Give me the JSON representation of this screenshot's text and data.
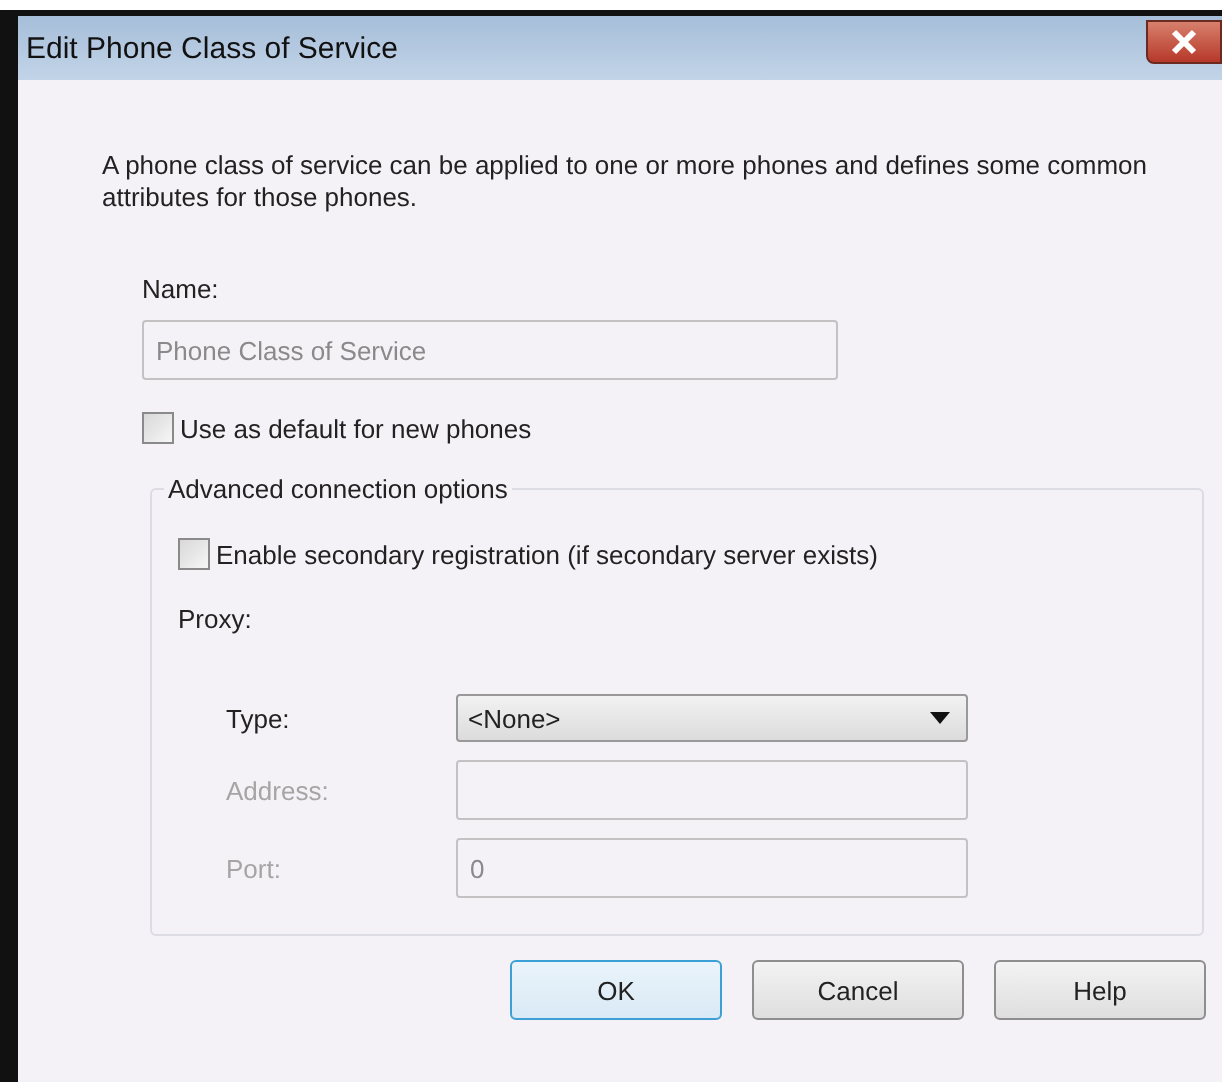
{
  "window": {
    "title": "Edit Phone Class of Service"
  },
  "description": "A phone class of service can be applied to one or more phones and defines some common attributes for those phones.",
  "name_field": {
    "label": "Name:",
    "placeholder": "Phone Class of Service",
    "disabled": true
  },
  "default_checkbox": {
    "label": "Use as default for new phones",
    "checked": false
  },
  "advanced_group": {
    "legend": "Advanced connection options",
    "secondary_checkbox": {
      "label": "Enable secondary registration (if secondary server exists)",
      "checked": false
    },
    "proxy_label": "Proxy:",
    "fields": [
      {
        "kind": "dropdown",
        "label": "Type:",
        "value": "<None>",
        "disabled": false
      },
      {
        "kind": "text",
        "label": "Address:",
        "disabled": true
      },
      {
        "kind": "text",
        "label": "Port:",
        "value": "0",
        "disabled": true
      }
    ]
  },
  "buttons": [
    {
      "label": "OK",
      "selected": true
    },
    {
      "label": "Cancel",
      "selected": false
    },
    {
      "label": "Help",
      "selected": false
    }
  ]
}
